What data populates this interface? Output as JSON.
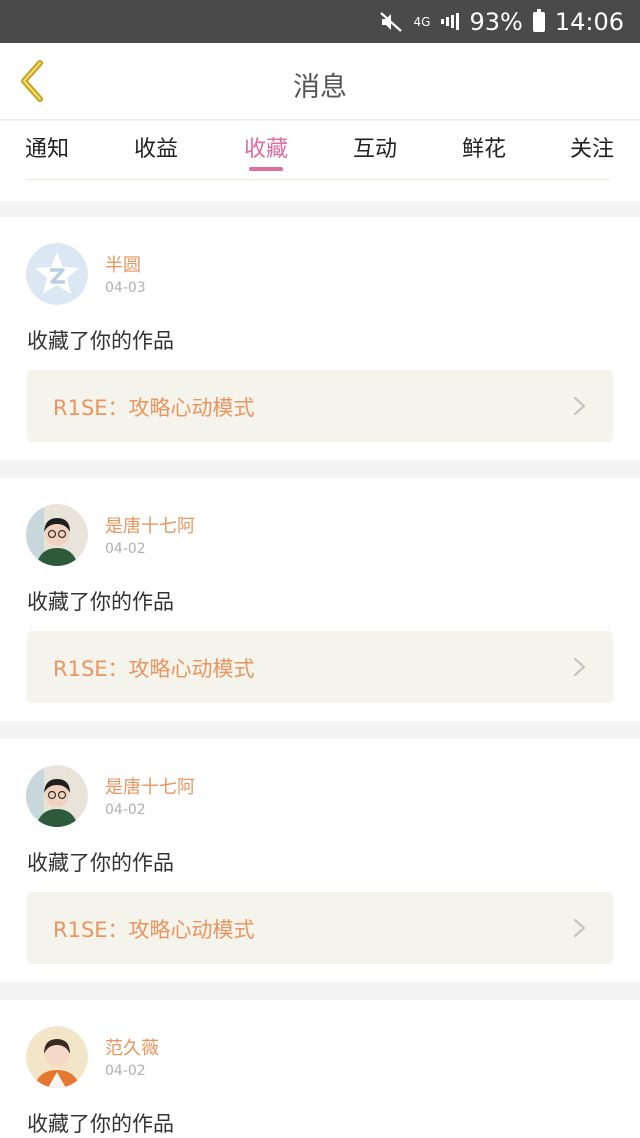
{
  "status_bar": {
    "network": "4G",
    "battery": "93%",
    "time": "14:06",
    "icons": [
      "mute-icon",
      "4g-icon",
      "signal-icon",
      "battery-icon"
    ]
  },
  "header": {
    "title": "消息",
    "back_icon": "chevron-left-icon",
    "back_color": "#c9a21c"
  },
  "tabs": [
    {
      "label": "通知"
    },
    {
      "label": "收益"
    },
    {
      "label": "收藏"
    },
    {
      "label": "互动"
    },
    {
      "label": "鲜花"
    },
    {
      "label": "关注"
    }
  ],
  "active_tab": "收藏",
  "colors": {
    "accent": "#e06ca0",
    "name": "#e89560",
    "work_box_bg": "#f5f4ec",
    "status_bar_bg": "#4a4a4a"
  },
  "items": [
    {
      "user": "半圆",
      "date": "04-03",
      "action": "收藏了你的作品",
      "work": "R1SE：攻略心动模式",
      "avatar": "default-avatar-icon"
    },
    {
      "user": "是唐十七阿",
      "date": "04-02",
      "action": "收藏了你的作品",
      "work": "R1SE：攻略心动模式",
      "avatar": "photo-avatar"
    },
    {
      "user": "是唐十七阿",
      "date": "04-02",
      "action": "收藏了你的作品",
      "work": "R1SE：攻略心动模式",
      "avatar": "photo-avatar"
    },
    {
      "user": "范久薇",
      "date": "04-02",
      "action": "收藏了你的作品",
      "work": "",
      "avatar": "photo-avatar"
    }
  ]
}
